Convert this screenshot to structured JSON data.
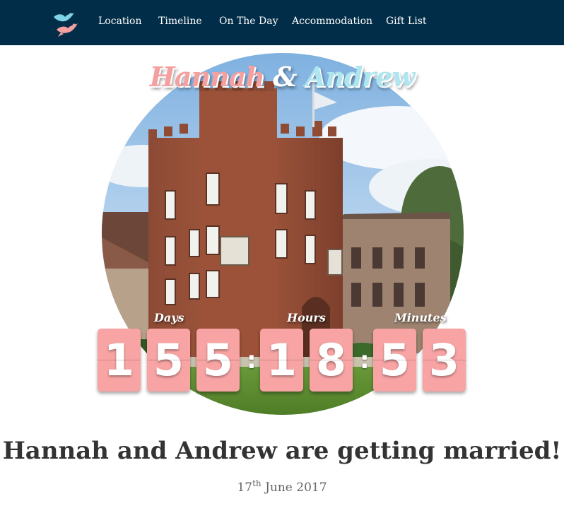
{
  "nav": {
    "logo": "lovebirds-logo",
    "links": [
      {
        "label": "Location"
      },
      {
        "label": "Timeline"
      },
      {
        "label": "On The Day"
      },
      {
        "label": "Accommodation"
      },
      {
        "label": "Gift List"
      }
    ]
  },
  "hero": {
    "image": "castle-photo",
    "name1": "Hannah",
    "amp": "&",
    "name2": "Andrew"
  },
  "countdown": {
    "labels": {
      "days": "Days",
      "hours": "Hours",
      "minutes": "Minutes"
    },
    "days": [
      "1",
      "5",
      "5"
    ],
    "hours": [
      "1",
      "8"
    ],
    "minutes": [
      "5",
      "3"
    ],
    "separator": ":"
  },
  "headline": "Hannah and Andrew are getting married!",
  "date": {
    "day": "17",
    "suffix": "th",
    "rest": " June 2017"
  },
  "colors": {
    "nav_bg": "#022d48",
    "digit_bg": "#f8a4a4",
    "pink": "#f5a0a0",
    "blue": "#aee5ef"
  }
}
